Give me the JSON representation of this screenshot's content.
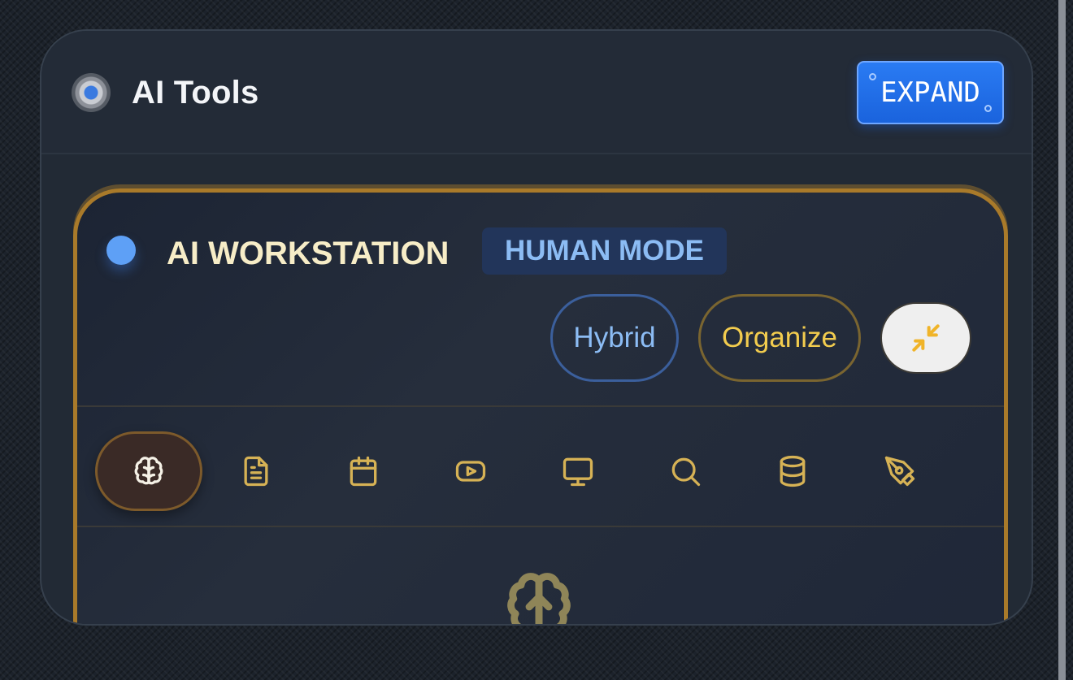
{
  "panel": {
    "title": "AI Tools",
    "expand_label": "EXPAND"
  },
  "workstation": {
    "title": "AI WORKSTATION",
    "mode_badge": "HUMAN MODE",
    "pills": {
      "hybrid": "Hybrid",
      "organize": "Organize"
    },
    "tools": [
      {
        "icon": "brain-icon",
        "active": true
      },
      {
        "icon": "document-icon",
        "active": false
      },
      {
        "icon": "calendar-icon",
        "active": false
      },
      {
        "icon": "video-play-icon",
        "active": false
      },
      {
        "icon": "monitor-icon",
        "active": false
      },
      {
        "icon": "search-icon",
        "active": false
      },
      {
        "icon": "database-icon",
        "active": false
      },
      {
        "icon": "pen-tool-icon",
        "active": false
      }
    ]
  },
  "colors": {
    "accent_gold": "#a97a2a",
    "accent_blue": "#1a63dd",
    "icon_gold": "#d6b255"
  }
}
